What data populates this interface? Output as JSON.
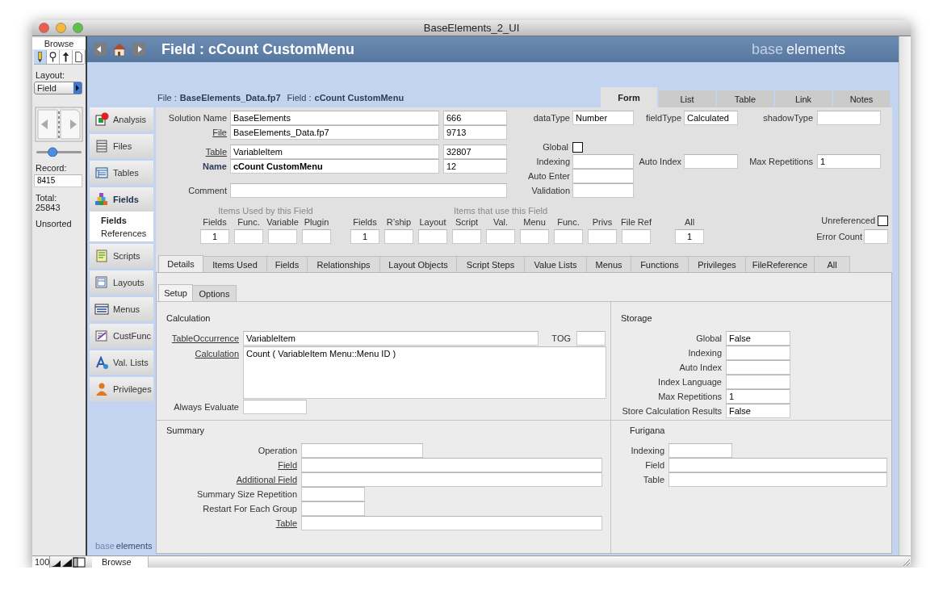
{
  "window": {
    "title": "BaseElements_2_UI"
  },
  "status_area": {
    "mode": "Browse",
    "tools": [
      {
        "kind": "pencil",
        "selected": true
      },
      {
        "kind": "magnifier",
        "selected": false
      },
      {
        "kind": "pointer",
        "selected": false
      },
      {
        "kind": "page",
        "selected": false
      }
    ],
    "layout_label": "Layout:",
    "layout": "Field",
    "record_slider": {
      "level": 0.33
    },
    "record_label": "Record:",
    "record": "8415",
    "total_label": "Total:",
    "total": "25843",
    "sort_state": "Unsorted"
  },
  "bottom_bar": {
    "zoom": "100",
    "mode": "Browse"
  },
  "header": {
    "title": "Field : cCount CustomMenu",
    "brand_light": "base",
    "brand_strong": "elements"
  },
  "breadcrumb": [
    {
      "label": "File :",
      "value": "BaseElements_Data.fp7"
    },
    {
      "label": "Field :",
      "value": "cCount CustomMenu"
    }
  ],
  "view_tabs": [
    {
      "label": "Form",
      "selected": true
    },
    {
      "label": "List",
      "selected": false
    },
    {
      "label": "Table",
      "selected": false
    },
    {
      "label": "Link",
      "selected": false
    },
    {
      "label": "Notes",
      "selected": false
    }
  ],
  "nav": [
    {
      "label": "Analysis",
      "kind": "analysis",
      "selected": false
    },
    {
      "label": "Files",
      "kind": "files",
      "selected": false
    },
    {
      "label": "Tables",
      "kind": "tables",
      "selected": false
    },
    {
      "label": "Fields",
      "kind": "fields",
      "selected": true,
      "children": [
        {
          "label": "Fields",
          "selected": true
        },
        {
          "label": "References",
          "selected": false
        }
      ]
    },
    {
      "label": "Scripts",
      "kind": "scripts",
      "selected": false
    },
    {
      "label": "Layouts",
      "kind": "layouts",
      "selected": false
    },
    {
      "label": "Menus",
      "kind": "menus",
      "selected": false
    },
    {
      "label": "CustFunc",
      "kind": "custfunc",
      "selected": false
    },
    {
      "label": "Val. Lists",
      "kind": "valuelists",
      "selected": false
    },
    {
      "label": "Privileges",
      "kind": "privileges",
      "selected": false
    }
  ],
  "nav_footer": {
    "brand_light": "base",
    "brand_strong": "elements"
  },
  "identity": [
    {
      "label": "Solution Name",
      "link": false,
      "emphasis": false,
      "value": "BaseElements",
      "number": "666"
    },
    {
      "label": "File",
      "link": true,
      "emphasis": false,
      "value": "BaseElements_Data.fp7",
      "number": "9713"
    },
    {
      "label": "Table",
      "link": true,
      "emphasis": false,
      "value": "VariableItem",
      "number": "32807"
    },
    {
      "label": "Name",
      "link": false,
      "emphasis": true,
      "value": "cCount CustomMenu",
      "number": "12"
    },
    {
      "label": "Comment",
      "link": false,
      "emphasis": false
    }
  ],
  "properties": {
    "types": [
      {
        "label": "dataType",
        "value": "Number"
      },
      {
        "label": "fieldType",
        "value": "Calculated"
      },
      {
        "label": "shadowType"
      }
    ],
    "global": {
      "label": "Global",
      "checked": false
    },
    "options": [
      {
        "label": "Indexing"
      },
      {
        "label": "Auto Index"
      },
      {
        "label": "Max Repetitions",
        "value": "1"
      }
    ],
    "auto_enter": {
      "label": "Auto Enter"
    },
    "validation": {
      "label": "Validation"
    }
  },
  "items_used": {
    "title": "Items Used by this Field",
    "columns": [
      {
        "label": "Fields",
        "value": "1"
      },
      {
        "label": "Func."
      },
      {
        "label": "Variable"
      },
      {
        "label": "Plugin"
      }
    ]
  },
  "used_by": {
    "title": "Items that use this Field",
    "columns": [
      {
        "label": "Fields",
        "value": "1"
      },
      {
        "label": "R’ship"
      },
      {
        "label": "Layout"
      },
      {
        "label": "Script"
      },
      {
        "label": "Val."
      },
      {
        "label": "Menu"
      },
      {
        "label": "Func."
      },
      {
        "label": "Privs"
      },
      {
        "label": "File Ref"
      }
    ]
  },
  "all": {
    "label": "All",
    "value": "1"
  },
  "unreferenced": {
    "label": "Unreferenced",
    "checked": false
  },
  "error_count": {
    "label": "Error Count"
  },
  "detail_tabs": [
    {
      "label": "Details",
      "selected": true
    },
    {
      "label": "Items Used",
      "selected": false
    },
    {
      "label": "Fields",
      "selected": false
    },
    {
      "label": "Relationships",
      "selected": false
    },
    {
      "label": "Layout Objects",
      "selected": false
    },
    {
      "label": "Script Steps",
      "selected": false
    },
    {
      "label": "Value Lists",
      "selected": false
    },
    {
      "label": "Menus",
      "selected": false
    },
    {
      "label": "Functions",
      "selected": false
    },
    {
      "label": "Privileges",
      "selected": false
    },
    {
      "label": "FileReference",
      "selected": false
    },
    {
      "label": "All",
      "selected": false
    }
  ],
  "sub_tabs": [
    {
      "label": "Setup",
      "selected": true
    },
    {
      "label": "Options",
      "selected": false
    }
  ],
  "calculation": {
    "title": "Calculation",
    "table_occurrence": {
      "label": "TableOccurrence",
      "link": true,
      "value": "VariableItem"
    },
    "tog": {
      "label": "TOG"
    },
    "formula": {
      "label": "Calculation",
      "link": true,
      "value": "Count ( VariableItem Menu::Menu ID )"
    },
    "always_evaluate": {
      "label": "Always Evaluate"
    }
  },
  "storage": {
    "title": "Storage",
    "rows": [
      {
        "label": "Global",
        "value": "False"
      },
      {
        "label": "Indexing"
      },
      {
        "label": "Auto Index"
      },
      {
        "label": "Index Language"
      },
      {
        "label": "Max Repetitions",
        "value": "1"
      },
      {
        "label": "Store Calculation Results",
        "value": "False"
      }
    ]
  },
  "summary": {
    "title": "Summary",
    "rows": [
      {
        "label": "Operation",
        "link": false
      },
      {
        "label": "Field",
        "link": true
      },
      {
        "label": "Additional Field",
        "link": true
      },
      {
        "label": "Summary Size Repetition",
        "link": false
      },
      {
        "label": "Restart For Each Group",
        "link": false
      },
      {
        "label": "Table",
        "link": true
      }
    ]
  },
  "furigana": {
    "title": "Furigana",
    "rows": [
      {
        "label": "Indexing"
      },
      {
        "label": "Field"
      },
      {
        "label": "Table"
      }
    ]
  }
}
